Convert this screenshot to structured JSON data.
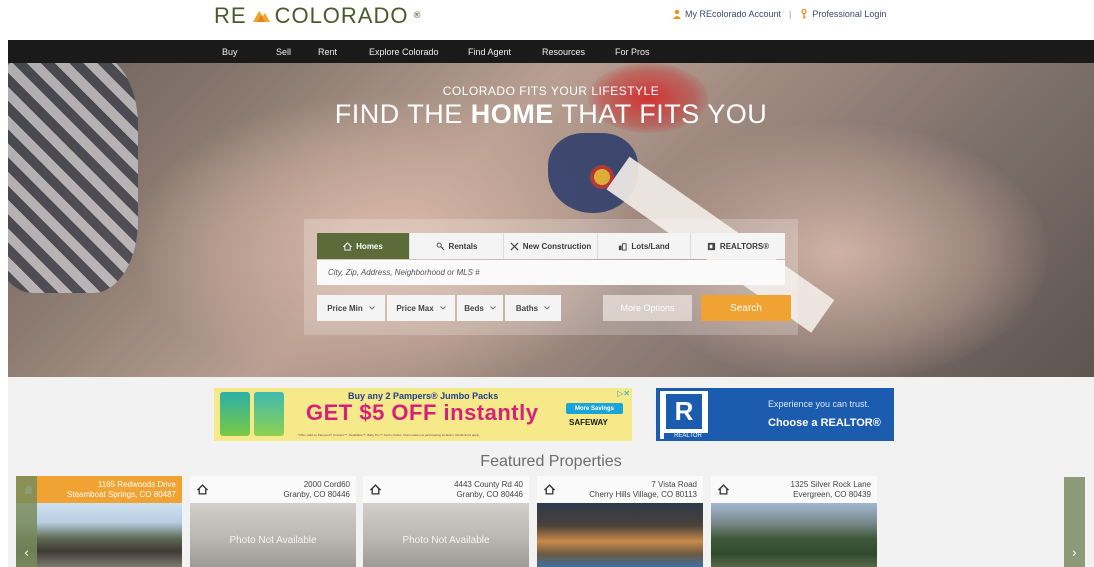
{
  "header": {
    "logo": {
      "re": "RE",
      "colorado": "COLORADO",
      "reg": "®"
    },
    "my_account": "My REcolorado Account",
    "professional_login": "Professional Login",
    "separator": "|"
  },
  "nav": {
    "items": [
      "Buy",
      "Sell",
      "Rent",
      "Explore Colorado",
      "Find Agent",
      "Resources",
      "For Pros"
    ]
  },
  "hero": {
    "tagline": "COLORADO FITS YOUR LIFESTYLE",
    "headline_pre": "FIND THE ",
    "headline_bold": "HOME",
    "headline_post": " THAT FITS YOU"
  },
  "search": {
    "tabs": [
      {
        "label": "Homes",
        "icon": "house-icon",
        "active": true
      },
      {
        "label": "Rentals",
        "icon": "key-icon",
        "active": false
      },
      {
        "label": "New Construction",
        "icon": "tools-icon",
        "active": false
      },
      {
        "label": "Lots/Land",
        "icon": "land-icon",
        "active": false
      },
      {
        "label": "REALTORS®",
        "icon": "realtor-icon",
        "active": false
      }
    ],
    "placeholder": "City, Zip, Address, Neighborhood or MLS #",
    "filters": [
      "Price Min",
      "Price Max",
      "Beds",
      "Baths"
    ],
    "more_options": "More Options",
    "search_button": "Search"
  },
  "ads": {
    "pampers": {
      "top": "Buy any 2 Pampers® Jumbo Packs",
      "main": "GET $5 OFF instantly",
      "cta": "More Savings",
      "store": "SAFEWAY",
      "fine": "*Offer valid on Pampers® Cruisers™, Swaddlers™, Baby Dry™ Jumbo Packs. Must redeem at participating locations. Restrictions apply."
    },
    "realtor": {
      "logo_letter": "R",
      "logo_word": "REALTOR",
      "line1": "Experience you can trust.",
      "line2": "Choose a REALTOR®"
    }
  },
  "featured": {
    "title": "Featured Properties",
    "photo_not_available": "Photo Not Available",
    "properties": [
      {
        "address": "1165 Redwoods Drive",
        "city": "Steamboat Springs, CO 80487",
        "photo": "available"
      },
      {
        "address": "2000 Cord60",
        "city": "Granby, CO 80446",
        "photo": "not_available"
      },
      {
        "address": "4443 County Rd 40",
        "city": "Granby, CO 80446",
        "photo": "not_available"
      },
      {
        "address": "7 Vista Road",
        "city": "Cherry Hills Village, CO 80113",
        "photo": "available"
      },
      {
        "address": "1325 Silver Rock Lane",
        "city": "Evergreen, CO 80439",
        "photo": "available"
      }
    ],
    "prev": "‹",
    "next": "›"
  },
  "colors": {
    "nav_bg": "#1a1a1a",
    "brand_green": "#5c6b3a",
    "accent_orange": "#f0a232",
    "realtor_blue": "#1c5cae"
  }
}
